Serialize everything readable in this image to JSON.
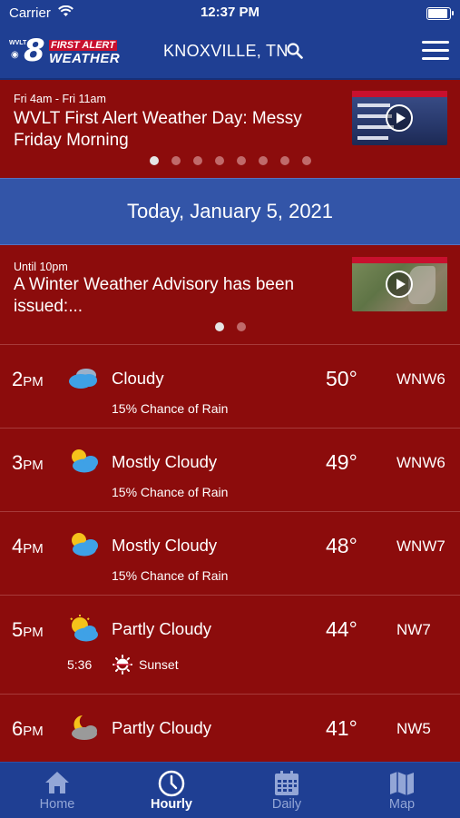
{
  "status_bar": {
    "carrier": "Carrier",
    "time": "12:37 PM"
  },
  "header": {
    "logo": {
      "station": "WVLT",
      "number": "8",
      "network": "CBS",
      "line1": "FIRST ALERT",
      "line2": "WEATHER"
    },
    "location": "KNOXVILLE, TN"
  },
  "stories": [
    {
      "meta": "Fri 4am - Fri 11am",
      "title": "WVLT First Alert Weather Day: Messy Friday Morning",
      "dots": 8,
      "active_dot": 0
    },
    {
      "meta": "Until 10pm",
      "title": "A Winter Weather Advisory has been issued:...",
      "dots": 2,
      "active_dot": 0
    }
  ],
  "date_banner": "Today, January 5, 2021",
  "hourly": [
    {
      "hour": "2",
      "ampm": "PM",
      "icon": "cloudy-icon",
      "condition": "Cloudy",
      "temp": "50°",
      "wind": "WNW6",
      "detail": "15% Chance of Rain"
    },
    {
      "hour": "3",
      "ampm": "PM",
      "icon": "mostly-cloudy-icon",
      "condition": "Mostly Cloudy",
      "temp": "49°",
      "wind": "WNW6",
      "detail": "15% Chance of Rain"
    },
    {
      "hour": "4",
      "ampm": "PM",
      "icon": "mostly-cloudy-icon",
      "condition": "Mostly Cloudy",
      "temp": "48°",
      "wind": "WNW7",
      "detail": "15% Chance of Rain"
    },
    {
      "hour": "5",
      "ampm": "PM",
      "icon": "partly-cloudy-icon",
      "condition": "Partly Cloudy",
      "temp": "44°",
      "wind": "NW7",
      "sunset_time": "5:36",
      "sunset_label": "Sunset"
    },
    {
      "hour": "6",
      "ampm": "PM",
      "icon": "partly-cloudy-night-icon",
      "condition": "Partly Cloudy",
      "temp": "41°",
      "wind": "NW5"
    }
  ],
  "tabs": [
    {
      "label": "Home",
      "icon": "home-icon",
      "active": false
    },
    {
      "label": "Hourly",
      "icon": "clock-icon",
      "active": true
    },
    {
      "label": "Daily",
      "icon": "calendar-icon",
      "active": false
    },
    {
      "label": "Map",
      "icon": "map-icon",
      "active": false
    }
  ],
  "colors": {
    "background": "#8c0c0c",
    "header": "#1f3f93",
    "date_band": "#3355a8",
    "tab_inactive": "#93a6d6"
  }
}
